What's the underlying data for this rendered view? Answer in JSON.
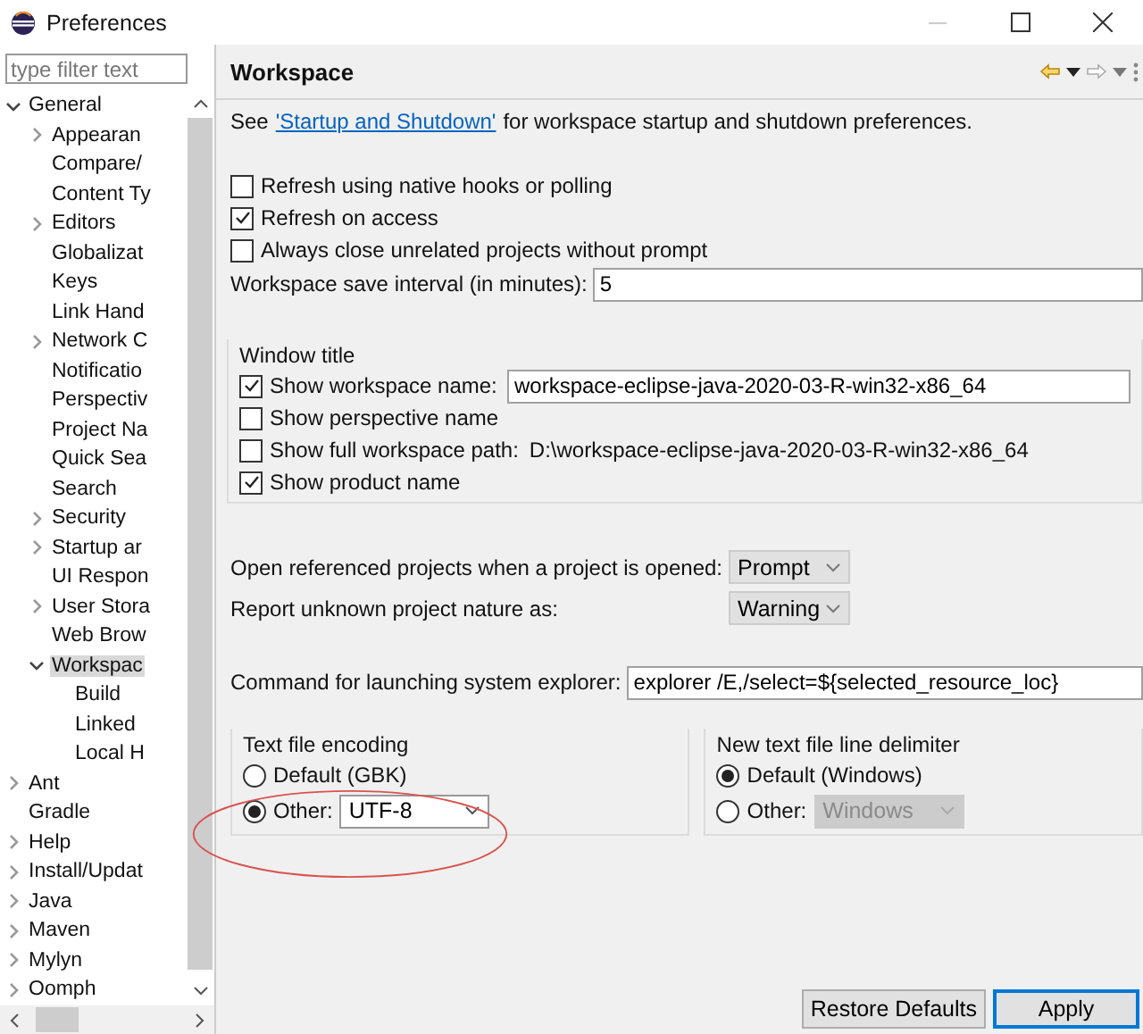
{
  "window": {
    "title": "Preferences"
  },
  "filter": {
    "placeholder": "type filter text"
  },
  "tree": [
    {
      "label": "General",
      "expanded": true,
      "selected": false,
      "children": [
        {
          "label": "Appearan",
          "expanded": false,
          "selected": false
        },
        {
          "label": "Compare/",
          "selected": false
        },
        {
          "label": "Content Ty",
          "selected": false
        },
        {
          "label": "Editors",
          "expanded": false,
          "selected": false
        },
        {
          "label": "Globalizat",
          "selected": false
        },
        {
          "label": "Keys",
          "selected": false
        },
        {
          "label": "Link Hand",
          "selected": false
        },
        {
          "label": "Network C",
          "expanded": false,
          "selected": false
        },
        {
          "label": "Notificatio",
          "selected": false
        },
        {
          "label": "Perspectiv",
          "selected": false
        },
        {
          "label": "Project Na",
          "selected": false
        },
        {
          "label": "Quick Sea",
          "selected": false
        },
        {
          "label": "Search",
          "selected": false
        },
        {
          "label": "Security",
          "expanded": false,
          "selected": false
        },
        {
          "label": "Startup ar",
          "expanded": false,
          "selected": false
        },
        {
          "label": "UI Respon",
          "selected": false
        },
        {
          "label": "User Stora",
          "expanded": false,
          "selected": false
        },
        {
          "label": "Web Brow",
          "selected": false
        },
        {
          "label": "Workspac",
          "expanded": true,
          "selected": true,
          "children": [
            {
              "label": "Build",
              "selected": false
            },
            {
              "label": "Linked",
              "selected": false
            },
            {
              "label": "Local H",
              "selected": false
            }
          ]
        }
      ]
    },
    {
      "label": "Ant",
      "expanded": false,
      "selected": false
    },
    {
      "label": "Gradle",
      "selected": false
    },
    {
      "label": "Help",
      "expanded": false,
      "selected": false
    },
    {
      "label": "Install/Updat",
      "expanded": false,
      "selected": false
    },
    {
      "label": "Java",
      "expanded": false,
      "selected": false
    },
    {
      "label": "Maven",
      "expanded": false,
      "selected": false
    },
    {
      "label": "Mylyn",
      "expanded": false,
      "selected": false
    },
    {
      "label": "Oomph",
      "expanded": false,
      "selected": false
    }
  ],
  "page": {
    "title": "Workspace",
    "intro": {
      "before": "See",
      "link": "'Startup and Shutdown'",
      "after": "for workspace startup and shutdown preferences."
    },
    "checkboxes": [
      {
        "label": "Refresh using native hooks or polling",
        "checked": false
      },
      {
        "label": "Refresh on access",
        "checked": true
      },
      {
        "label": "Always close unrelated projects without prompt",
        "checked": false
      }
    ],
    "save_interval": {
      "label": "Workspace save interval (in minutes):",
      "value": "5"
    },
    "window_title": {
      "title": "Window title",
      "items": [
        {
          "label": "Show workspace name:",
          "checked": true,
          "kind": "field",
          "value": "workspace-eclipse-java-2020-03-R-win32-x86_64"
        },
        {
          "label": "Show perspective name",
          "checked": false,
          "kind": "plain"
        },
        {
          "label": "Show full workspace path:",
          "checked": false,
          "kind": "text",
          "value": "D:\\workspace-eclipse-java-2020-03-R-win32-x86_64"
        },
        {
          "label": "Show product name",
          "checked": true,
          "kind": "plain"
        }
      ]
    },
    "combos": [
      {
        "label": "Open referenced projects when a project is opened:",
        "value": "Prompt"
      },
      {
        "label": "Report unknown project nature as:",
        "value": "Warning"
      }
    ],
    "explorer": {
      "label": "Command for launching system explorer:",
      "value": "explorer /E,/select=${selected_resource_loc}"
    },
    "groups": [
      {
        "title": "Text file encoding",
        "options": [
          {
            "label": "Default (GBK)",
            "selected": false
          },
          {
            "label": "Other:",
            "selected": true,
            "combo": {
              "value": "UTF-8",
              "disabled": false
            }
          }
        ]
      },
      {
        "title": "New text file line delimiter",
        "options": [
          {
            "label": "Default (Windows)",
            "selected": true
          },
          {
            "label": "Other:",
            "selected": false,
            "combo": {
              "value": "Windows",
              "disabled": true
            }
          }
        ]
      }
    ],
    "buttons": [
      {
        "label": "Restore Defaults",
        "default": false
      },
      {
        "label": "Apply",
        "default": true
      }
    ]
  }
}
